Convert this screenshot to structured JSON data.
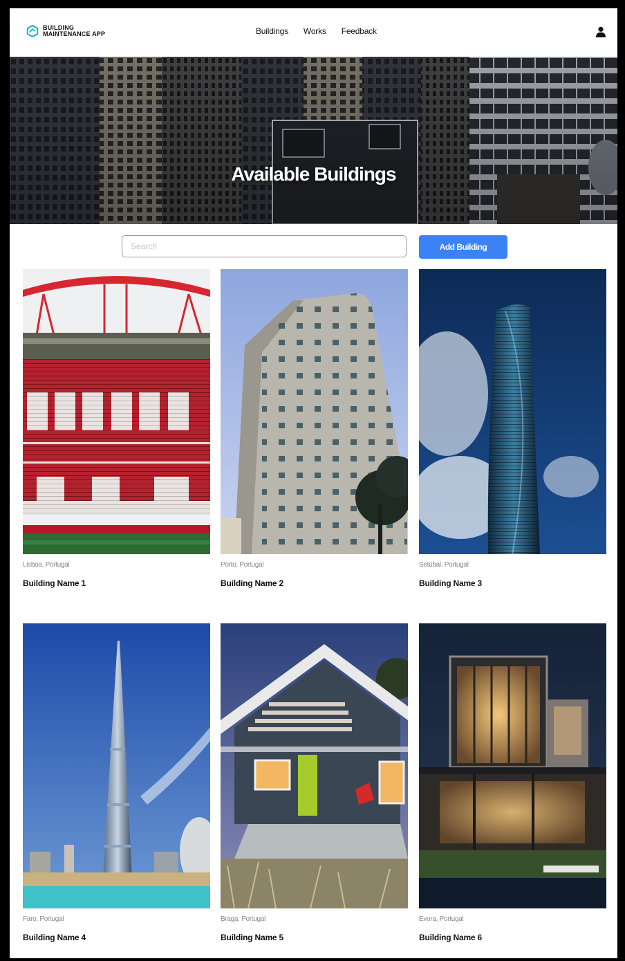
{
  "app": {
    "logo_line1": "BUILDING",
    "logo_line2": "MAINTENANCE APP",
    "accent": "#3b82f6",
    "logo_color": "#1fb6c9"
  },
  "nav": {
    "items": [
      {
        "label": "Buildings"
      },
      {
        "label": "Works"
      },
      {
        "label": "Feedback"
      }
    ],
    "user_icon": "user-icon"
  },
  "hero": {
    "title": "Available Buildings"
  },
  "search": {
    "placeholder": "Search",
    "value": ""
  },
  "actions": {
    "add_building_label": "Add Building"
  },
  "buildings": [
    {
      "location": "Lisboa, Portugal",
      "name": "Building Name 1",
      "image": "stadium-photo"
    },
    {
      "location": "Porto, Portugal",
      "name": "Building Name 2",
      "image": "white-tower-photo"
    },
    {
      "location": "Setúbal, Portugal",
      "name": "Building Name 3",
      "image": "twisted-skyscraper-photo"
    },
    {
      "location": "Faro, Portugal",
      "name": "Building Name 4",
      "image": "burj-tower-photo"
    },
    {
      "location": "Braga, Portugal",
      "name": "Building Name 5",
      "image": "modern-house-photo"
    },
    {
      "location": "Evora, Portugal",
      "name": "Building Name 6",
      "image": "night-villa-photo"
    }
  ]
}
